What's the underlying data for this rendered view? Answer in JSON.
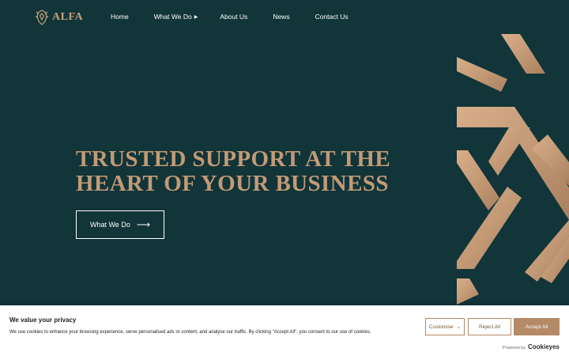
{
  "header": {
    "logo_text": "ALFA",
    "nav": [
      {
        "label": "Home"
      },
      {
        "label": "What We Do",
        "has_submenu": true
      },
      {
        "label": "About Us"
      },
      {
        "label": "News"
      },
      {
        "label": "Contact Us"
      }
    ]
  },
  "hero": {
    "title_line1": "TRUSTED SUPPORT AT THE",
    "title_line2": "HEART OF YOUR BUSINESS",
    "cta_label": "What We Do"
  },
  "cookie_banner": {
    "title": "We value your privacy",
    "text": "We use cookies to enhance your browsing experience, serve personalised ads or content, and analyse our traffic. By clicking \"Accept All\", you consent to our use of cookies.",
    "customise_label": "Customise",
    "reject_label": "Reject All",
    "accept_label": "Accept All",
    "powered_by": "Powered by",
    "powered_brand": "Cookieyes"
  },
  "colors": {
    "background": "#113539",
    "accent": "#c39a76",
    "button_accent": "#b48a67"
  },
  "icons": {
    "logo": "lion-crest-icon",
    "submenu": "caret-right-icon",
    "cta_arrow": "arrow-right-icon",
    "customise_dropdown": "chevron-down-icon"
  }
}
